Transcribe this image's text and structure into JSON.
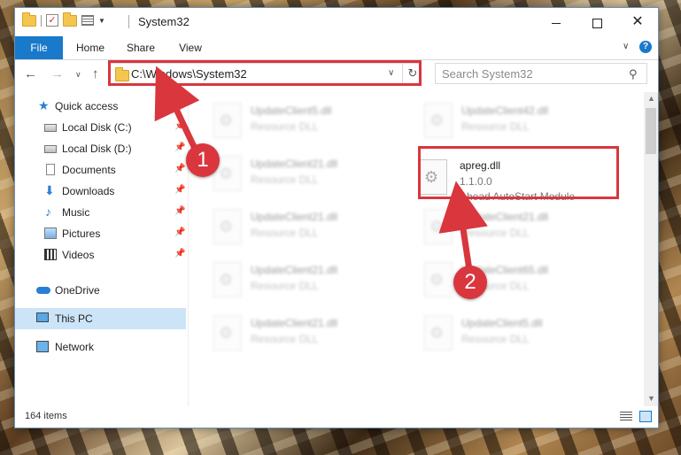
{
  "window": {
    "title": "System32",
    "buttons": {
      "minimize": "",
      "maximize": "",
      "close": "✕"
    }
  },
  "ribbon": {
    "tabs": [
      "File",
      "Home",
      "Share",
      "View"
    ],
    "help": "?"
  },
  "address": {
    "path": "C:\\Windows\\System32",
    "search_placeholder": "Search System32"
  },
  "sidebar": {
    "items": [
      {
        "label": "Quick access",
        "icon": "star-icon",
        "pinned": false
      },
      {
        "label": "Local Disk (C:)",
        "icon": "drive-icon",
        "pinned": true
      },
      {
        "label": "Local Disk (D:)",
        "icon": "drive-icon",
        "pinned": true
      },
      {
        "label": "Documents",
        "icon": "documents-icon",
        "pinned": true
      },
      {
        "label": "Downloads",
        "icon": "download-icon",
        "pinned": true
      },
      {
        "label": "Music",
        "icon": "music-icon",
        "pinned": true
      },
      {
        "label": "Pictures",
        "icon": "pictures-icon",
        "pinned": true
      },
      {
        "label": "Videos",
        "icon": "videos-icon",
        "pinned": true
      },
      {
        "label": "OneDrive",
        "icon": "cloud-icon",
        "pinned": false
      },
      {
        "label": "This PC",
        "icon": "computer-icon",
        "pinned": false,
        "selected": true
      },
      {
        "label": "Network",
        "icon": "network-icon",
        "pinned": false
      }
    ]
  },
  "files": [
    {
      "name": "UpdateClient5.dll",
      "desc": "Resource DLL",
      "blurred": true
    },
    {
      "name": "UpdateClient42.dll",
      "desc": "Resource DLL",
      "blurred": true
    },
    {
      "name": "UpdateClient21.dll",
      "desc": "Resource DLL",
      "blurred": true
    },
    {
      "name": "UpdateClient21.dll",
      "desc": "Resource DLL",
      "blurred": true
    },
    {
      "name": "UpdateClient21.dll",
      "desc": "Resource DLL",
      "blurred": true
    },
    {
      "name": "UpdateClient21.dll",
      "desc": "Resource DLL",
      "blurred": true
    },
    {
      "name": "UpdateClient65.dll",
      "desc": "Resource DLL",
      "blurred": true
    },
    {
      "name": "UpdateClient21.dll",
      "desc": "Resource DLL",
      "blurred": true
    },
    {
      "name": "UpdateClient5.dll",
      "desc": "Resource DLL",
      "blurred": true
    }
  ],
  "highlight_file": {
    "name": "apreg.dll",
    "version": "1.1.0.0",
    "desc": "Ahead AutoStart Module"
  },
  "status": {
    "items": "164 items"
  },
  "annotations": {
    "step1": "1",
    "step2": "2",
    "color": "#d9363e"
  }
}
